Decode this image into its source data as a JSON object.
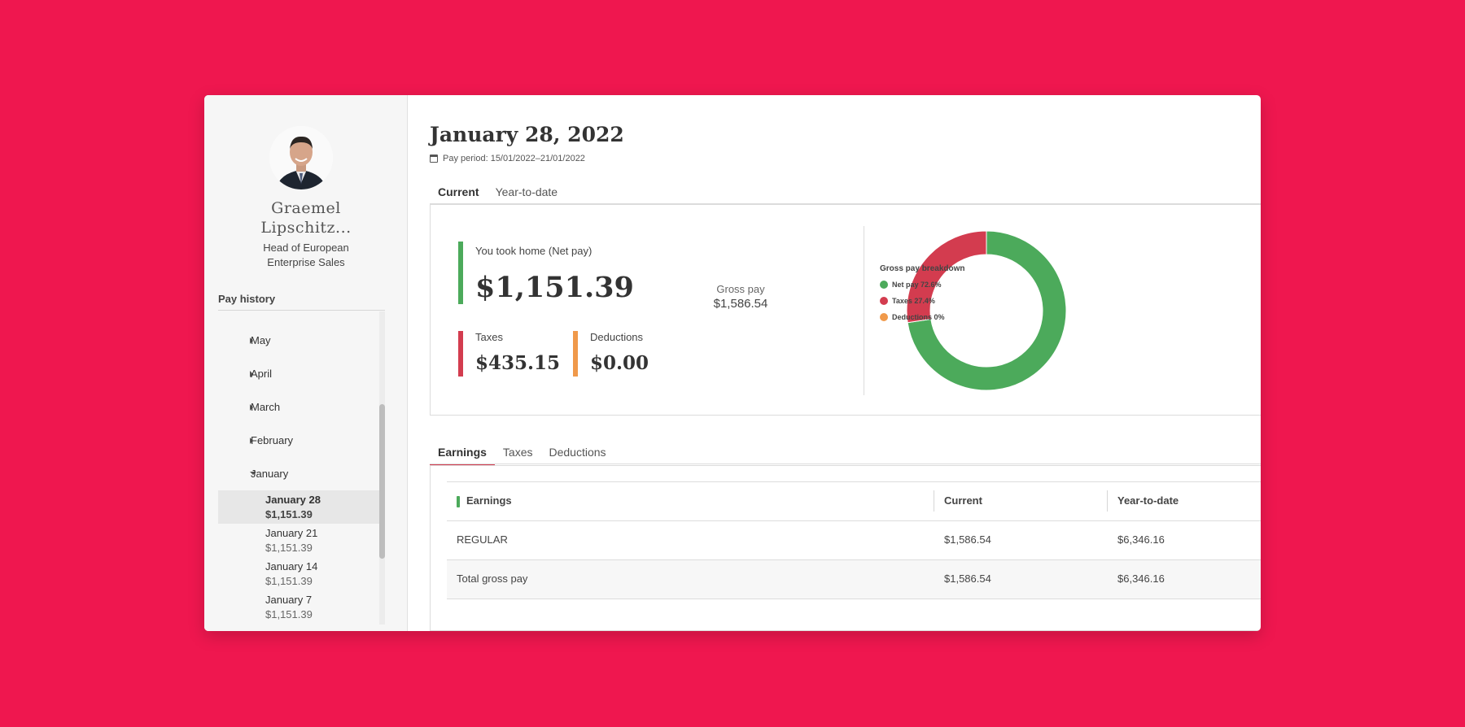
{
  "colors": {
    "background": "#ef174f",
    "net": "#4caa5b",
    "taxes": "#d33c4f",
    "deductions": "#f0994a",
    "accent": "#d33c4f"
  },
  "profile": {
    "name_line1": "Graemel",
    "name_line2": "Lipschitz...",
    "role": "Head of European Enterprise Sales"
  },
  "sidebar": {
    "pay_history_label": "Pay history",
    "months": [
      {
        "label": "May",
        "expanded": false
      },
      {
        "label": "April",
        "expanded": false
      },
      {
        "label": "March",
        "expanded": false
      },
      {
        "label": "February",
        "expanded": false
      },
      {
        "label": "January",
        "expanded": true
      }
    ],
    "entries": [
      {
        "date": "January 28",
        "amount": "$1,151.39",
        "selected": true
      },
      {
        "date": "January 21",
        "amount": "$1,151.39",
        "selected": false
      },
      {
        "date": "January 14",
        "amount": "$1,151.39",
        "selected": false
      },
      {
        "date": "January 7",
        "amount": "$1,151.39",
        "selected": false
      }
    ]
  },
  "header": {
    "title": "January 28, 2022",
    "pay_period": "Pay period: 15/01/2022–21/01/2022"
  },
  "period_tabs": [
    {
      "label": "Current",
      "active": true
    },
    {
      "label": "Year-to-date",
      "active": false
    }
  ],
  "summary": {
    "net_label": "You took home (Net pay)",
    "net_value": "$1,151.39",
    "taxes_label": "Taxes",
    "taxes_value": "$435.15",
    "deductions_label": "Deductions",
    "deductions_value": "$0.00"
  },
  "chart_data": {
    "type": "pie",
    "center_label": "Gross pay",
    "center_value": "$1,586.54",
    "title": "Gross pay breakdown",
    "slices": [
      {
        "label": "Net pay 72.6%",
        "value": 72.6,
        "color": "#4caa5b"
      },
      {
        "label": "Taxes 27.4%",
        "value": 27.4,
        "color": "#d33c4f"
      },
      {
        "label": "Deductions 0%",
        "value": 0,
        "color": "#f0994a"
      }
    ]
  },
  "detail_tabs": [
    {
      "label": "Earnings",
      "active": true
    },
    {
      "label": "Taxes",
      "active": false
    },
    {
      "label": "Deductions",
      "active": false
    }
  ],
  "earnings_table": {
    "columns": [
      "Earnings",
      "Current",
      "Year-to-date"
    ],
    "rows": [
      [
        "REGULAR",
        "$1,586.54",
        "$6,346.16"
      ],
      [
        "Total gross pay",
        "$1,586.54",
        "$6,346.16"
      ]
    ]
  }
}
